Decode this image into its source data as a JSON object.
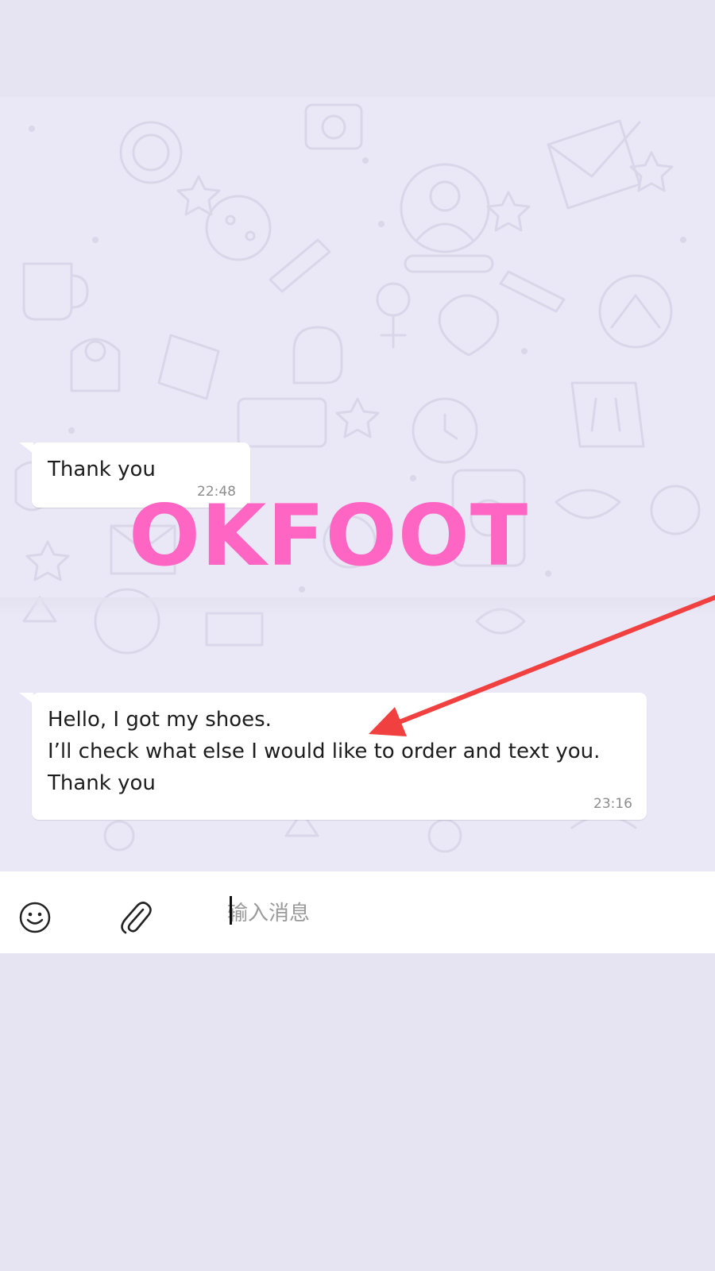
{
  "chat": {
    "messages": [
      {
        "lines": [
          "Thank you"
        ],
        "time": "22:48"
      },
      {
        "lines": [
          "Hello, I got my shoes.",
          "I’ll check what else I would like to order and text you.",
          "Thank you"
        ],
        "time": "23:16"
      }
    ]
  },
  "overlay": {
    "watermark": "OKFOOT",
    "watermark_color": "#ff66c4",
    "arrow_color": "#f04040"
  },
  "composer": {
    "placeholder": "输入消息",
    "emoji_icon": "smiley-icon",
    "attach_icon": "paperclip-icon"
  },
  "colors": {
    "chat_background": "#eae8f6",
    "bubble": "#ffffff",
    "page_background": "#e6e4f2"
  }
}
